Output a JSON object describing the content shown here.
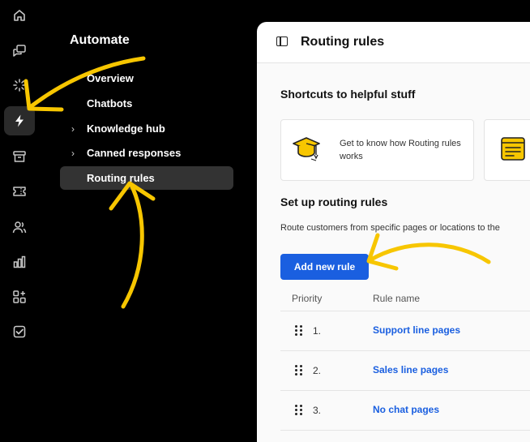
{
  "rail": {
    "icons": [
      "home-icon",
      "chats-icon",
      "sparkle-icon",
      "bolt-icon",
      "archive-icon",
      "ticket-icon",
      "team-icon",
      "reports-icon",
      "apps-icon",
      "checkbox-icon"
    ],
    "active": "bolt-icon"
  },
  "panel": {
    "title": "Automate",
    "items": [
      {
        "label": "Overview",
        "chevron": false
      },
      {
        "label": "Chatbots",
        "chevron": false
      },
      {
        "label": "Knowledge hub",
        "chevron": true
      },
      {
        "label": "Canned responses",
        "chevron": true
      },
      {
        "label": "Routing rules",
        "chevron": false,
        "active": true
      }
    ]
  },
  "main": {
    "title": "Routing rules",
    "shortcuts_heading": "Shortcuts to helpful stuff",
    "shortcut_card_text": "Get to know how Routing rules works",
    "setup_heading": "Set up routing rules",
    "setup_description": "Route customers from specific pages or locations to the",
    "add_button": "Add new rule",
    "table": {
      "headers": [
        "Priority",
        "Rule name"
      ],
      "rows": [
        {
          "priority": "1.",
          "name": "Support line pages"
        },
        {
          "priority": "2.",
          "name": "Sales line pages"
        },
        {
          "priority": "3.",
          "name": "No chat pages"
        }
      ]
    }
  },
  "colors": {
    "accent": "#1a5fe0",
    "annotation": "#f7c600",
    "background": "#000000"
  }
}
